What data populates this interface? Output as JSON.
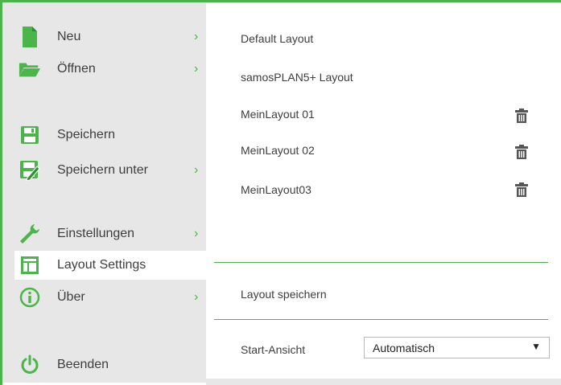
{
  "sidebar": {
    "items": [
      {
        "label": "Neu",
        "icon": "new-file-icon",
        "has_submenu": true
      },
      {
        "label": "Öffnen",
        "icon": "open-folder-icon",
        "has_submenu": true
      },
      {
        "label": "Speichern",
        "icon": "save-icon",
        "has_submenu": false
      },
      {
        "label": "Speichern unter",
        "icon": "save-as-icon",
        "has_submenu": true
      },
      {
        "label": "Einstellungen",
        "icon": "wrench-icon",
        "has_submenu": true
      },
      {
        "label": "Layout Settings",
        "icon": "layout-icon",
        "has_submenu": false,
        "active": true
      },
      {
        "label": "Über",
        "icon": "info-icon",
        "has_submenu": true
      },
      {
        "label": "Beenden",
        "icon": "power-icon",
        "has_submenu": false
      }
    ],
    "chevron": "›"
  },
  "layouts": [
    {
      "name": "Default Layout",
      "deletable": false
    },
    {
      "name": "samosPLAN5+ Layout",
      "deletable": false
    },
    {
      "name": "MeinLayout 01",
      "deletable": true
    },
    {
      "name": "MeinLayout 02",
      "deletable": true
    },
    {
      "name": "MeinLayout03",
      "deletable": true
    }
  ],
  "actions": {
    "save_layout": "Layout speichern"
  },
  "start_view": {
    "label": "Start-Ansicht",
    "value": "Automatisch"
  },
  "colors": {
    "accent": "#4bb44a",
    "sidebar_bg": "#e7e7e7",
    "text": "#3d3d3d",
    "icon_dark": "#3d3d3d"
  }
}
